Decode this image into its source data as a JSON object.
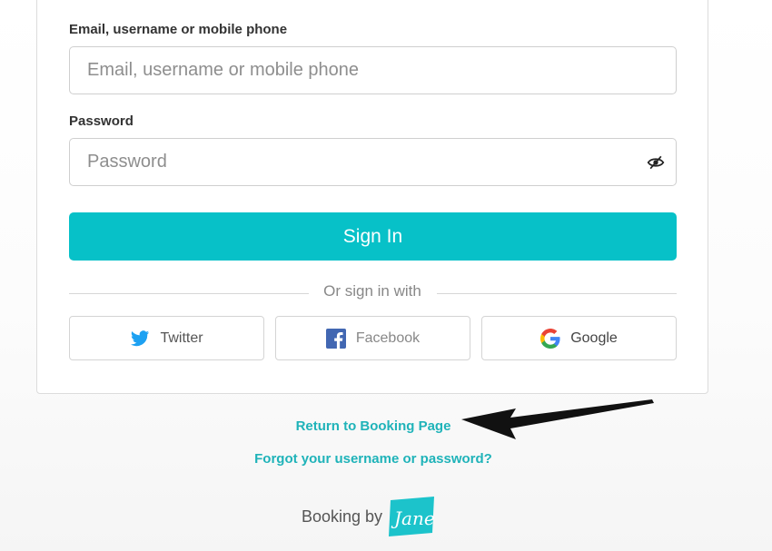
{
  "form": {
    "email_label": "Email, username or mobile phone",
    "email_placeholder": "Email, username or mobile phone",
    "password_label": "Password",
    "password_placeholder": "Password",
    "signin_label": "Sign In",
    "divider_text": "Or sign in with"
  },
  "social": [
    {
      "label": "Twitter",
      "icon": "twitter-icon",
      "color": "#1da1f2"
    },
    {
      "label": "Facebook",
      "icon": "facebook-icon",
      "color": "#4267b2"
    },
    {
      "label": "Google",
      "icon": "google-icon",
      "color": "#4285f4"
    }
  ],
  "links": {
    "return_booking": "Return to Booking Page",
    "forgot": "Forgot your username or password?"
  },
  "footer": {
    "booking_by": "Booking by",
    "logo_text": "Jane",
    "logo_color": "#1cc3cb"
  },
  "colors": {
    "accent": "#07c1c8",
    "link": "#1fb3b9"
  }
}
